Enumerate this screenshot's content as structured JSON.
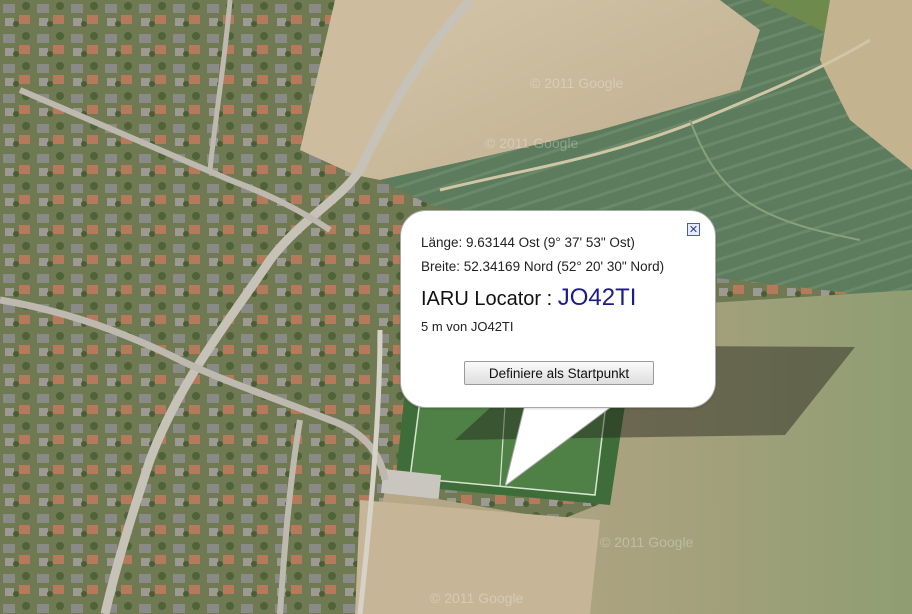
{
  "map": {
    "watermarks": [
      "© 2011 Google",
      "© 2011 Google",
      "© 2011 Google",
      "© 2011 Google"
    ]
  },
  "info_window": {
    "longitude_text": "Länge: 9.63144 Ost (9° 37' 53\" Ost)",
    "latitude_text": "Breite: 52.34169 Nord (52° 20' 30\" Nord)",
    "locator_label": "IARU Locator : ",
    "locator_value": "JO42TI",
    "distance_text": "5 m von JO42TI",
    "start_button_label": "Definiere als Startpunkt",
    "close_icon": "close-icon",
    "close_glyph": "✕"
  },
  "colors": {
    "locator_value": "#1b1b8a",
    "field_green": "#5f7f5c",
    "field_beige": "#c8b89a"
  }
}
